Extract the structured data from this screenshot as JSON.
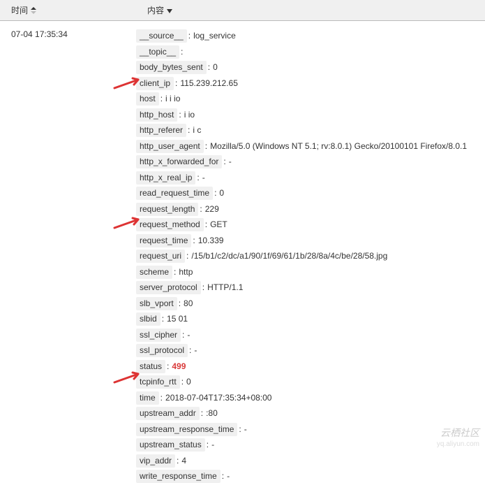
{
  "header": {
    "time_label": "时间",
    "content_label": "内容"
  },
  "record": {
    "timestamp": "07-04 17:35:34"
  },
  "fields": [
    {
      "key": "__source__",
      "value": "log_service"
    },
    {
      "key": "__topic__",
      "value": ""
    },
    {
      "key": "body_bytes_sent",
      "value": "0"
    },
    {
      "key": "client_ip",
      "value": "115.239.212.65"
    },
    {
      "key": "host",
      "value": "i   i  io"
    },
    {
      "key": "http_host",
      "value": "i  io"
    },
    {
      "key": "http_referer",
      "value": "i        c"
    },
    {
      "key": "http_user_agent",
      "value": "Mozilla/5.0 (Windows NT 5.1; rv:8.0.1) Gecko/20100101 Firefox/8.0.1"
    },
    {
      "key": "http_x_forwarded_for",
      "value": "-"
    },
    {
      "key": "http_x_real_ip",
      "value": "-"
    },
    {
      "key": "read_request_time",
      "value": "0"
    },
    {
      "key": "request_length",
      "value": "229"
    },
    {
      "key": "request_method",
      "value": "GET"
    },
    {
      "key": "request_time",
      "value": "10.339"
    },
    {
      "key": "request_uri",
      "value": "/15/b1/c2/dc/a1/90/1f/69/61/1b/28/8a/4c/be/28/58.jpg"
    },
    {
      "key": "scheme",
      "value": "http"
    },
    {
      "key": "server_protocol",
      "value": "HTTP/1.1"
    },
    {
      "key": "slb_vport",
      "value": "80"
    },
    {
      "key": "slbid",
      "value": "15                                         01"
    },
    {
      "key": "ssl_cipher",
      "value": "-"
    },
    {
      "key": "ssl_protocol",
      "value": "-"
    },
    {
      "key": "status",
      "value": "499",
      "highlight": true
    },
    {
      "key": "tcpinfo_rtt",
      "value": "0"
    },
    {
      "key": "time",
      "value": "2018-07-04T17:35:34+08:00"
    },
    {
      "key": "upstream_addr",
      "value": "                    :80"
    },
    {
      "key": "upstream_response_time",
      "value": "-"
    },
    {
      "key": "upstream_status",
      "value": "-"
    },
    {
      "key": "vip_addr",
      "value": "              4"
    },
    {
      "key": "write_response_time",
      "value": "-"
    }
  ],
  "watermark": {
    "text": "云栖社区",
    "url": "yq.aliyun.com"
  }
}
